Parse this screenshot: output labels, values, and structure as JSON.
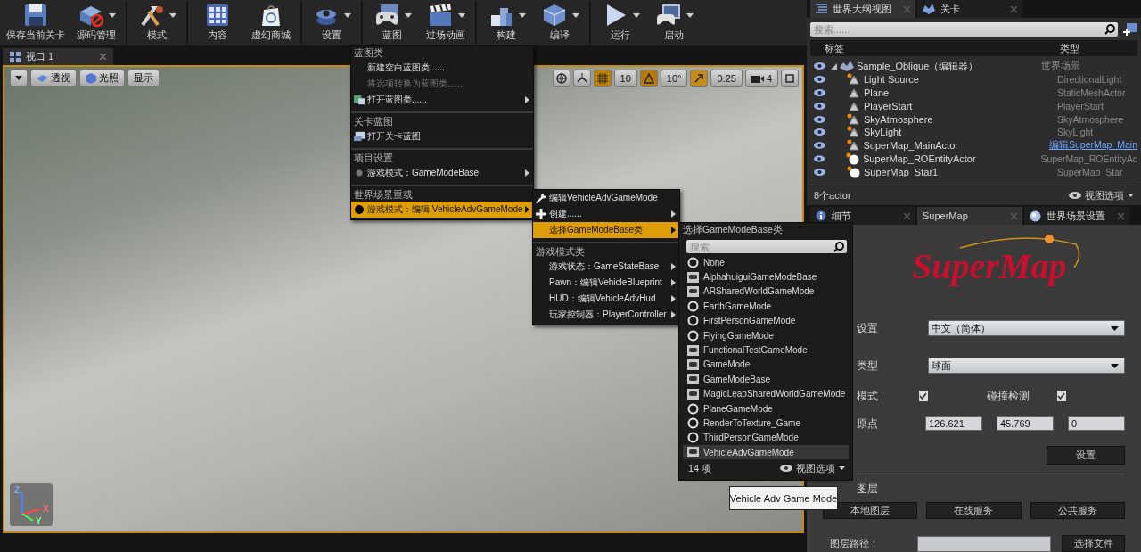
{
  "toolbar": [
    {
      "items": [
        {
          "label": "保存当前关卡",
          "kind": "save",
          "dropdown": false
        },
        {
          "label": "源码管理",
          "kind": "source",
          "dropdown": true
        }
      ]
    },
    {
      "items": [
        {
          "label": "模式",
          "kind": "modes",
          "dropdown": true
        }
      ]
    },
    {
      "items": [
        {
          "label": "内容",
          "kind": "content",
          "dropdown": false
        },
        {
          "label": "虚幻商城",
          "kind": "market",
          "dropdown": false
        }
      ]
    },
    {
      "items": [
        {
          "label": "设置",
          "kind": "settings",
          "dropdown": true
        }
      ]
    },
    {
      "items": [
        {
          "label": "蓝图",
          "kind": "blueprint",
          "dropdown": true
        },
        {
          "label": "过场动画",
          "kind": "cinematics",
          "dropdown": true
        }
      ]
    },
    {
      "items": [
        {
          "label": "构建",
          "kind": "build",
          "dropdown": true
        },
        {
          "label": "编译",
          "kind": "compile",
          "dropdown": true
        }
      ]
    },
    {
      "items": [
        {
          "label": "运行",
          "kind": "play",
          "dropdown": true
        },
        {
          "label": "启动",
          "kind": "launch",
          "dropdown": true
        }
      ]
    }
  ],
  "viewport": {
    "tab": "视口 1",
    "view_mode": "透视",
    "lighting": "光照",
    "show": "显示",
    "snaps": [
      {
        "kind": "grid",
        "on": true,
        "value": "10"
      },
      {
        "kind": "rotation",
        "on": true,
        "value": "10°"
      },
      {
        "kind": "scale",
        "on": true,
        "value": "0.25"
      }
    ],
    "camera_speed": "4",
    "axes": [
      "Z",
      "X",
      "Y"
    ]
  },
  "blueprint_menu": {
    "sections": [
      {
        "heading": "蓝图类",
        "items": [
          {
            "label": "新建空白蓝图类......",
            "kind": "plain",
            "disabled": false,
            "submenu": false,
            "selected": false
          },
          {
            "label": "将选项转换为蓝图类......",
            "kind": "plain",
            "disabled": true,
            "submenu": false,
            "selected": false
          },
          {
            "label": "打开蓝图类......",
            "kind": "blueprint",
            "disabled": false,
            "submenu": true,
            "selected": false
          }
        ]
      },
      {
        "heading": "关卡蓝图",
        "items": [
          {
            "label": "打开关卡蓝图",
            "kind": "level",
            "disabled": false,
            "submenu": false,
            "selected": false
          }
        ]
      },
      {
        "heading": "项目设置",
        "items": [
          {
            "label": "游戏模式：GameModeBase",
            "kind": "dot-dim",
            "disabled": false,
            "submenu": true,
            "selected": false
          }
        ]
      },
      {
        "heading": "世界场景重载",
        "items": [
          {
            "label": "游戏模式：编辑 VehicleAdvGameMode",
            "kind": "dot",
            "disabled": false,
            "submenu": true,
            "selected": true
          }
        ]
      }
    ]
  },
  "gamemode_menu": {
    "sections": [
      {
        "items": [
          {
            "label": "编辑VehicleAdvGameMode",
            "kind": "wrench",
            "submenu": false,
            "selected": false
          },
          {
            "label": "创建......",
            "kind": "plus",
            "submenu": true,
            "selected": false
          },
          {
            "label": "选择GameModeBase类",
            "kind": "plain",
            "submenu": true,
            "selected": true
          }
        ]
      },
      {
        "heading": "游戏模式类",
        "items": [
          {
            "label": "游戏状态：GameStateBase",
            "kind": "plain",
            "submenu": true,
            "selected": false
          },
          {
            "label": "Pawn：编辑VehicleBlueprint",
            "kind": "plain",
            "submenu": true,
            "selected": false
          },
          {
            "label": "HUD：编辑VehicleAdvHud",
            "kind": "plain",
            "submenu": true,
            "selected": false
          },
          {
            "label": "玩家控制器：PlayerController",
            "kind": "plain",
            "submenu": true,
            "selected": false
          }
        ]
      }
    ]
  },
  "class_picker": {
    "title": "选择GameModeBase类",
    "search": {
      "placeholder": "搜索"
    },
    "items": [
      {
        "label": "None",
        "kind": "native",
        "selected": false
      },
      {
        "label": "AlphahuiguiGameModeBase",
        "kind": "blueprint",
        "selected": false
      },
      {
        "label": "ARSharedWorldGameMode",
        "kind": "blueprint",
        "selected": false
      },
      {
        "label": "EarthGameMode",
        "kind": "native",
        "selected": false
      },
      {
        "label": "FirstPersonGameMode",
        "kind": "native",
        "selected": false
      },
      {
        "label": "FlyingGameMode",
        "kind": "native",
        "selected": false
      },
      {
        "label": "FunctionalTestGameMode",
        "kind": "blueprint",
        "selected": false
      },
      {
        "label": "GameMode",
        "kind": "blueprint",
        "selected": false
      },
      {
        "label": "GameModeBase",
        "kind": "blueprint",
        "selected": false
      },
      {
        "label": "MagicLeapSharedWorldGameMode",
        "kind": "blueprint",
        "selected": false
      },
      {
        "label": "PlaneGameMode",
        "kind": "native",
        "selected": false
      },
      {
        "label": "RenderToTexture_Game",
        "kind": "native",
        "selected": false
      },
      {
        "label": "ThirdPersonGameMode",
        "kind": "native",
        "selected": false
      },
      {
        "label": "VehicleAdvGameMode",
        "kind": "blueprint",
        "selected": true
      }
    ],
    "count": "14 项",
    "view_options": "视图选项",
    "tooltip": "Vehicle Adv Game Mode"
  },
  "outliner": {
    "tabs": [
      {
        "label": "世界大纲视图",
        "selected": true
      },
      {
        "label": "关卡",
        "selected": false
      }
    ],
    "search": {
      "placeholder": "搜索......"
    },
    "columns": [
      "标签",
      "类型"
    ],
    "rows": [
      {
        "label": "Sample_Oblique（编辑器）",
        "type": "世界场景",
        "expanded": true,
        "children": [
          {
            "label": "Light Source",
            "type": "DirectionalLight",
            "kind": "actor",
            "badge": true
          },
          {
            "label": "Plane",
            "type": "StaticMeshActor",
            "kind": "actor",
            "badge": false
          },
          {
            "label": "PlayerStart",
            "type": "PlayerStart",
            "kind": "actor",
            "badge": false
          },
          {
            "label": "SkyAtmosphere",
            "type": "SkyAtmosphere",
            "kind": "actor",
            "badge": true
          },
          {
            "label": "SkyLight",
            "type": "SkyLight",
            "kind": "actor",
            "badge": true
          },
          {
            "label": "SuperMap_MainActor",
            "type_link": "编辑SuperMap_Main",
            "kind": "actor",
            "badge": true
          },
          {
            "label": "SuperMap_ROEntityActor",
            "type": "SuperMap_ROEntityAc",
            "kind": "sphere",
            "badge": true
          },
          {
            "label": "SuperMap_Star1",
            "type": "SuperMap_Star",
            "kind": "sphere",
            "badge": true
          }
        ]
      }
    ],
    "count": "8个actor",
    "view_options": "视图选项"
  },
  "details": {
    "tabs": [
      {
        "label": "细节",
        "kind": "info",
        "selected": false
      },
      {
        "label": "SuperMap",
        "kind": "plain",
        "selected": true
      },
      {
        "label": "世界场景设置",
        "kind": "globe",
        "selected": false
      }
    ],
    "logo": "SuperMap",
    "language": {
      "label": "设置",
      "value": "中文（简体）"
    },
    "type": {
      "label": "类型",
      "value": "球面"
    },
    "mode": {
      "label": "模式",
      "checked": true
    },
    "collision": {
      "label": "碰撞检测",
      "checked": true
    },
    "origin": {
      "label": "原点",
      "values": [
        "126.621",
        "45.769",
        "0"
      ]
    },
    "set_button": "设置",
    "layers": {
      "heading": "图层",
      "buttons": [
        "本地图层",
        "在线服务",
        "公共服务"
      ],
      "path_label": "图层路径：",
      "choose_button": "选择文件"
    }
  }
}
